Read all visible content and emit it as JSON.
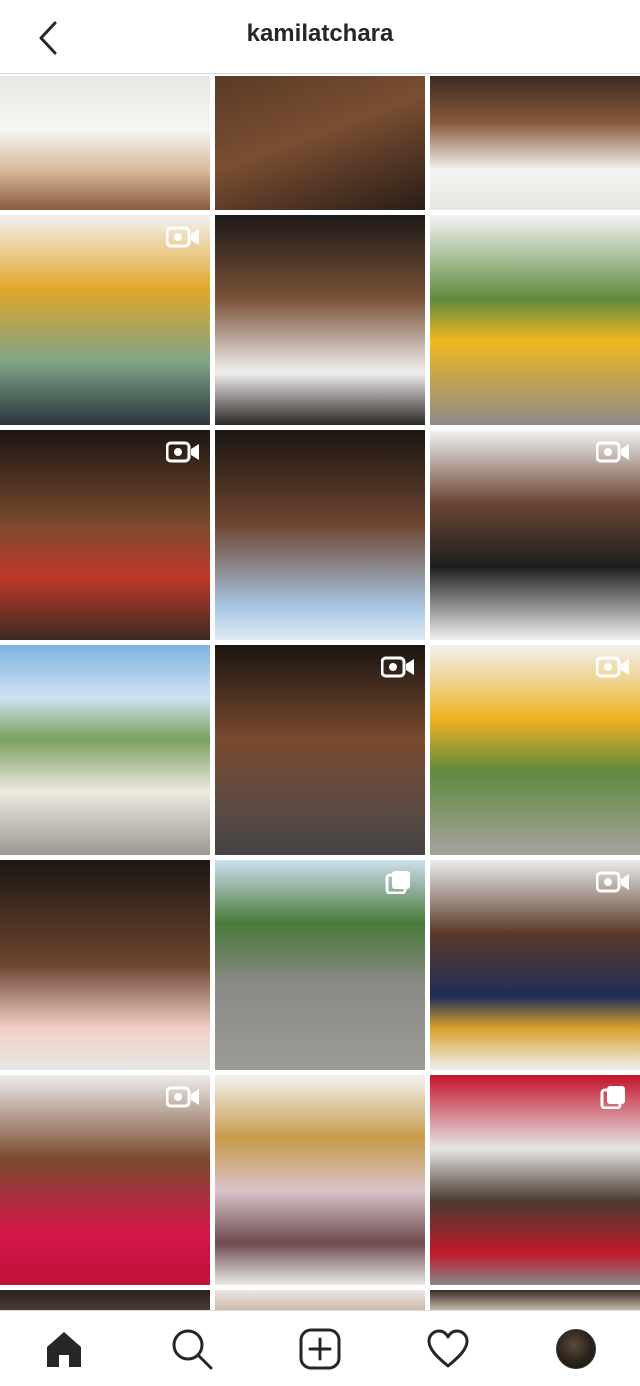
{
  "header": {
    "title": "kamilatchara",
    "back_icon": "chevron-left-icon"
  },
  "grid": {
    "posts": [
      {
        "bg": "linear-gradient(180deg,#e9e7e3 0%,#f7f6f4 40%,#d9b99a 70%,#8a5a3c 100%)",
        "indicator": "none"
      },
      {
        "bg": "linear-gradient(160deg,#5a3a26 0%,#7a4e32 45%,#2a1d16 100%)",
        "indicator": "none"
      },
      {
        "bg": "linear-gradient(180deg,#3b2a20 0%,#8a5a3a 35%,#f3f3f1 70%,#e8e6e3 100%)",
        "indicator": "none"
      },
      {
        "bg": "linear-gradient(180deg,#f2f2f2 0%,#e2a62a 35%,#7fa585 70%,#2a3440 100%)",
        "indicator": "video"
      },
      {
        "bg": "linear-gradient(180deg,#1e1a18 0%,#7a5238 40%,#f0efee 75%,#2a2624 100%)",
        "indicator": "none"
      },
      {
        "bg": "linear-gradient(180deg,#f4f4f4 0%,#5f8a3e 40%,#f0b822 60%,#8b8b88 100%)",
        "indicator": "none"
      },
      {
        "bg": "linear-gradient(180deg,#1c1512 0%,#7a4a2e 45%,#c0392b 70%,#3a2a22 100%)",
        "indicator": "video"
      },
      {
        "bg": "linear-gradient(180deg,#1a1512 0%,#6e4530 45%,#a8c8e6 85%,#dfe9f3 100%)",
        "indicator": "none"
      },
      {
        "bg": "linear-gradient(180deg,#f3f3f3 0%,#6b4532 35%,#1e1e1e 65%,#f1f1f1 100%)",
        "indicator": "video"
      },
      {
        "bg": "linear-gradient(180deg,#7fb2e0 0%,#cfe2f2 25%,#7aa060 45%,#efe9e0 70%,#9a9890 100%)",
        "indicator": "none"
      },
      {
        "bg": "linear-gradient(180deg,#1a1512 0%,#7a4a2e 45%,#5a4a44 80%,#444 100%)",
        "indicator": "video"
      },
      {
        "bg": "linear-gradient(180deg,#f1f1f1 0%,#f0b222 35%,#5f8a3e 60%,#a5a29c 100%)",
        "indicator": "video"
      },
      {
        "bg": "linear-gradient(180deg,#1c1714 0%,#6e4530 50%,#f1cfc6 80%,#e9e7e4 100%)",
        "indicator": "none"
      },
      {
        "bg": "linear-gradient(180deg,#cde0ef 0%,#4a7a3a 30%,#8a8a86 60%,#9d9b95 100%)",
        "indicator": "carousel"
      },
      {
        "bg": "linear-gradient(180deg,#ececec 0%,#5a3a26 35%,#1e2d5a 65%,#d8a12a 80%,#efefef 100%)",
        "indicator": "video"
      },
      {
        "bg": "linear-gradient(180deg,#ededed 0%,#7a4a2e 40%,#d5174a 75%,#c01038 100%)",
        "indicator": "video"
      },
      {
        "bg": "linear-gradient(180deg,#f3f3f0 0%,#c89a4a 30%,#d9c4c9 55%,#6e4a4e 80%,#eaeaea 100%)",
        "indicator": "none"
      },
      {
        "bg": "linear-gradient(180deg,#c4142a 0%,#e6e6e6 35%,#4a3a2e 60%,#c01a2a 85%,#888 100%)",
        "indicator": "carousel"
      },
      {
        "bg": "linear-gradient(180deg,#2a221c 0%,#4a3a30 100%)",
        "indicator": "none"
      },
      {
        "bg": "linear-gradient(180deg,#e9e7e5 0%,#cdb9a5 100%)",
        "indicator": "none"
      },
      {
        "bg": "linear-gradient(180deg,#3a2a22 0%,#c9b8a8 100%)",
        "indicator": "none"
      }
    ]
  },
  "nav": {
    "items": [
      {
        "icon": "home-icon"
      },
      {
        "icon": "search-icon"
      },
      {
        "icon": "new-post-icon"
      },
      {
        "icon": "activity-heart-icon"
      },
      {
        "icon": "profile-avatar"
      }
    ]
  }
}
